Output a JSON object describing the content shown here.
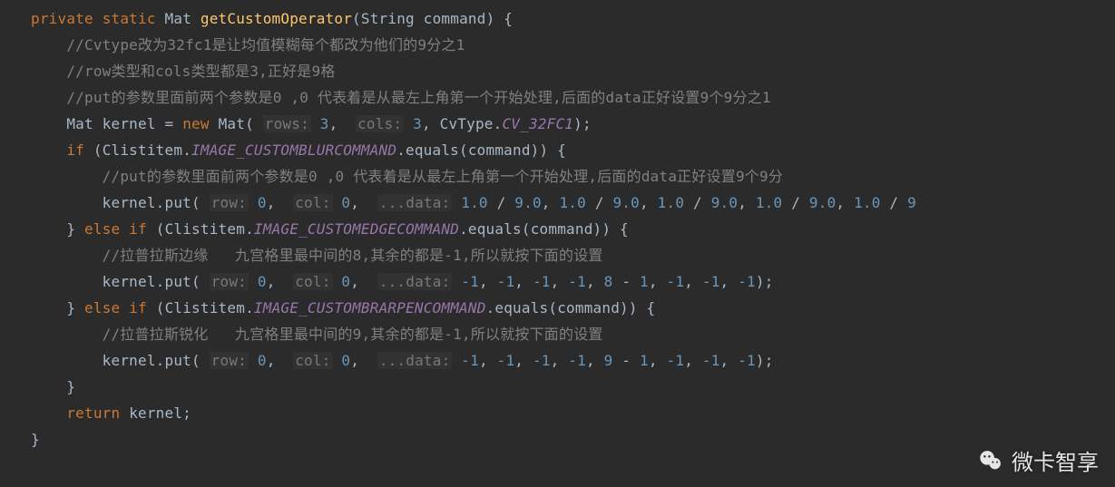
{
  "code": {
    "line1": {
      "kw_private": "private",
      "kw_static": "static",
      "ret_type": "Mat",
      "method": "getCustomOperator",
      "param_type": "String",
      "param_name": "command",
      "brace": "{"
    },
    "line2": {
      "comment": "//Cvtype改为32fc1是让均值模糊每个都改为他们的9分之1"
    },
    "line3": {
      "comment": "//row类型和cols类型都是3,正好是9格"
    },
    "line4": {
      "comment": "//put的参数里面前两个参数是0 ,0 代表着是从最左上角第一个开始处理,后面的data正好设置9个9分之1"
    },
    "line5": {
      "lhs_type": "Mat",
      "lhs_name": "kernel",
      "assign": "=",
      "kw_new": "new",
      "ctor": "Mat",
      "hint_rows": "rows:",
      "rows_val": "3",
      "hint_cols": "cols:",
      "cols_val": "3",
      "cvtype_ns": "CvType",
      "cv_const": "CV_32FC1",
      "tail": ");"
    },
    "line6": {
      "kw_if": "if",
      "cls": "Clistitem",
      "const": "IMAGE_CUSTOMBLURCOMMAND",
      "eq": ".equals(command)) {"
    },
    "line7": {
      "comment": "//put的参数里面前两个参数是0 ,0 代表着是从最左上角第一个开始处理,后面的data正好设置9个9分"
    },
    "line8": {
      "target": "kernel.put(",
      "hint_row": "row:",
      "row_val": "0",
      "hint_col": "col:",
      "col_val": "0",
      "hint_data": "...data:",
      "d1": "1.0",
      "s1": "/",
      "n1": "9.0",
      "d2": "1.0",
      "s2": "/",
      "n2": "9.0",
      "d3": "1.0",
      "s3": "/",
      "n3": "9.0",
      "d4": "1.0",
      "s4": "/",
      "n4": "9.0",
      "d5": "1.0",
      "s5": "/",
      "n5": "9"
    },
    "line9": {
      "brace": "}",
      "kw_else": "else",
      "kw_if": "if",
      "cls": "Clistitem",
      "const": "IMAGE_CUSTOMEDGECOMMAND",
      "eq": ".equals(command)) {"
    },
    "line10": {
      "comment": "//拉普拉斯边缘   九宫格里最中间的8,其余的都是-1,所以就按下面的设置"
    },
    "line11": {
      "target": "kernel.put(",
      "hint_row": "row:",
      "row_val": "0",
      "hint_col": "col:",
      "col_val": "0",
      "hint_data": "...data:",
      "v1": "-1",
      "v2": "-1",
      "v3": "-1",
      "v4": "-1",
      "center": "8",
      "minus": "-",
      "one": "1",
      "v6": "-1",
      "v7": "-1",
      "v8": "-1",
      "tail": ");"
    },
    "line12": {
      "brace": "}",
      "kw_else": "else",
      "kw_if": "if",
      "cls": "Clistitem",
      "const": "IMAGE_CUSTOMBRARPENCOMMAND",
      "eq": ".equals(command)) {"
    },
    "line13": {
      "comment": "//拉普拉斯锐化   九宫格里最中间的9,其余的都是-1,所以就按下面的设置"
    },
    "line14": {
      "target": "kernel.put(",
      "hint_row": "row:",
      "row_val": "0",
      "hint_col": "col:",
      "col_val": "0",
      "hint_data": "...data:",
      "v1": "-1",
      "v2": "-1",
      "v3": "-1",
      "v4": "-1",
      "center": "9",
      "minus": "-",
      "one": "1",
      "v6": "-1",
      "v7": "-1",
      "v8": "-1",
      "tail": ");"
    },
    "line15": {
      "brace": "}"
    },
    "line16": {
      "kw_return": "return",
      "expr": "kernel;"
    },
    "line17": {
      "brace": "}"
    }
  },
  "watermark": {
    "text": "微卡智享",
    "icon": "wechat-icon"
  }
}
